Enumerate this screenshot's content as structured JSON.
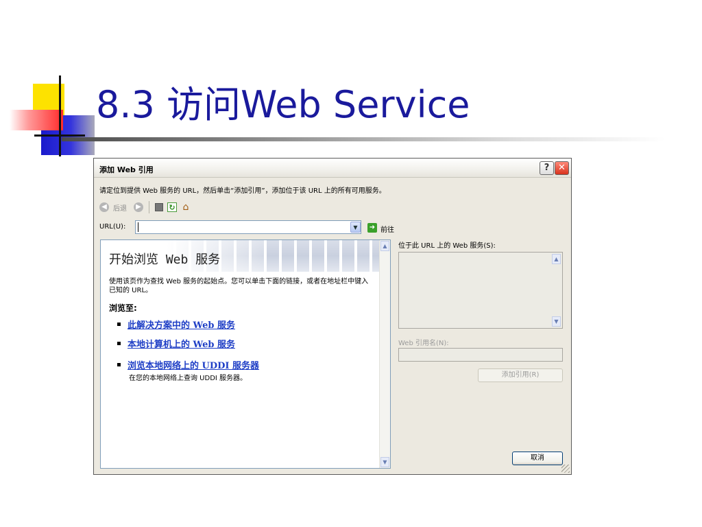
{
  "slide": {
    "title": "8.3  访问Web Service"
  },
  "dialog": {
    "title": "添加 Web 引用",
    "help_button": "?",
    "close_button": "✕",
    "instruction": "请定位到提供 Web 服务的 URL，然后单击“添加引用”，添加位于该 URL 上的所有可用服务。",
    "nav": {
      "back_label": "后退"
    },
    "url": {
      "label": "URL(U):",
      "value": "",
      "go_label": "前往"
    },
    "browser": {
      "heading": "开始浏览 Web 服务",
      "description": "使用该页作为查找 Web 服务的起始点。您可以单击下面的链接，或者在地址栏中键入已知的 URL。",
      "browse_to": "浏览至:",
      "links": [
        "此解决方案中的 Web 服务",
        "本地计算机上的 Web 服务",
        "浏览本地网络上的 UDDI 服务器"
      ],
      "uddi_description": "在您的本地网络上查询 UDDI 服务器。"
    },
    "right_panel": {
      "services_label": "位于此 URL 上的 Web 服务(S):",
      "ref_name_label": "Web 引用名(N):",
      "ref_name_value": "",
      "add_reference_button": "添加引用(R)",
      "cancel_button": "取消"
    }
  }
}
